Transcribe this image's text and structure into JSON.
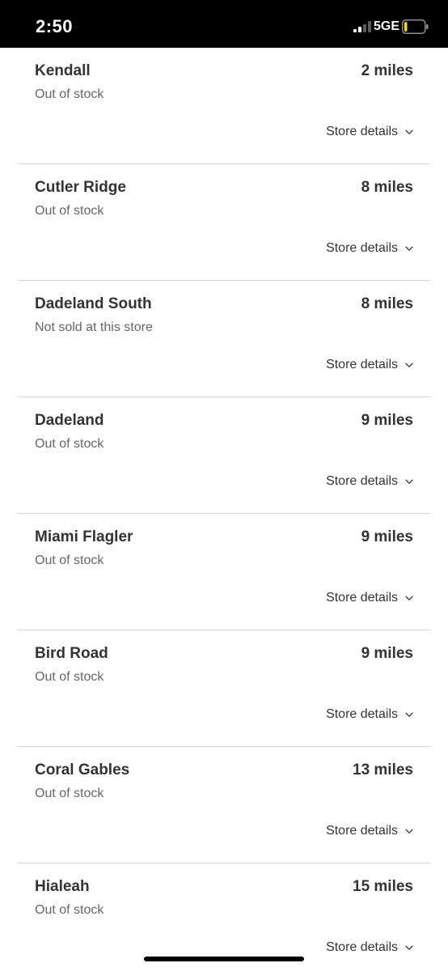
{
  "status_bar": {
    "time": "2:50",
    "network": "5GE",
    "signal_bars_active": 2,
    "battery_level": 0.15,
    "battery_color": "#ffd60a"
  },
  "stores": [
    {
      "name": "Kendall",
      "distance": "2 miles",
      "stock": "Out of stock",
      "details_label": "Store details"
    },
    {
      "name": "Cutler Ridge",
      "distance": "8 miles",
      "stock": "Out of stock",
      "details_label": "Store details"
    },
    {
      "name": "Dadeland South",
      "distance": "8 miles",
      "stock": "Not sold at this store",
      "details_label": "Store details"
    },
    {
      "name": "Dadeland",
      "distance": "9 miles",
      "stock": "Out of stock",
      "details_label": "Store details"
    },
    {
      "name": "Miami Flagler",
      "distance": "9 miles",
      "stock": "Out of stock",
      "details_label": "Store details"
    },
    {
      "name": "Bird Road",
      "distance": "9 miles",
      "stock": "Out of stock",
      "details_label": "Store details"
    },
    {
      "name": "Coral Gables",
      "distance": "13 miles",
      "stock": "Out of stock",
      "details_label": "Store details"
    },
    {
      "name": "Hialeah",
      "distance": "15 miles",
      "stock": "Out of stock",
      "details_label": "Store details"
    }
  ]
}
